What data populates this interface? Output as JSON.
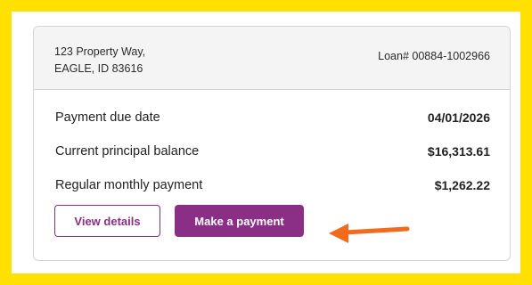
{
  "address": {
    "line1": "123 Property Way,",
    "line2": "EAGLE, ID 83616"
  },
  "loan": {
    "label": "Loan#",
    "number": "00884-1002966"
  },
  "details": [
    {
      "label": "Payment due date",
      "value": "04/01/2026"
    },
    {
      "label": "Current principal balance",
      "value": "$16,313.61"
    },
    {
      "label": "Regular monthly payment",
      "value": "$1,262.22"
    }
  ],
  "actions": {
    "view_details": "View details",
    "make_payment": "Make a payment"
  },
  "colors": {
    "frame": "#ffe000",
    "brand": "#8b2e86",
    "arrow": "#f26b1d"
  }
}
